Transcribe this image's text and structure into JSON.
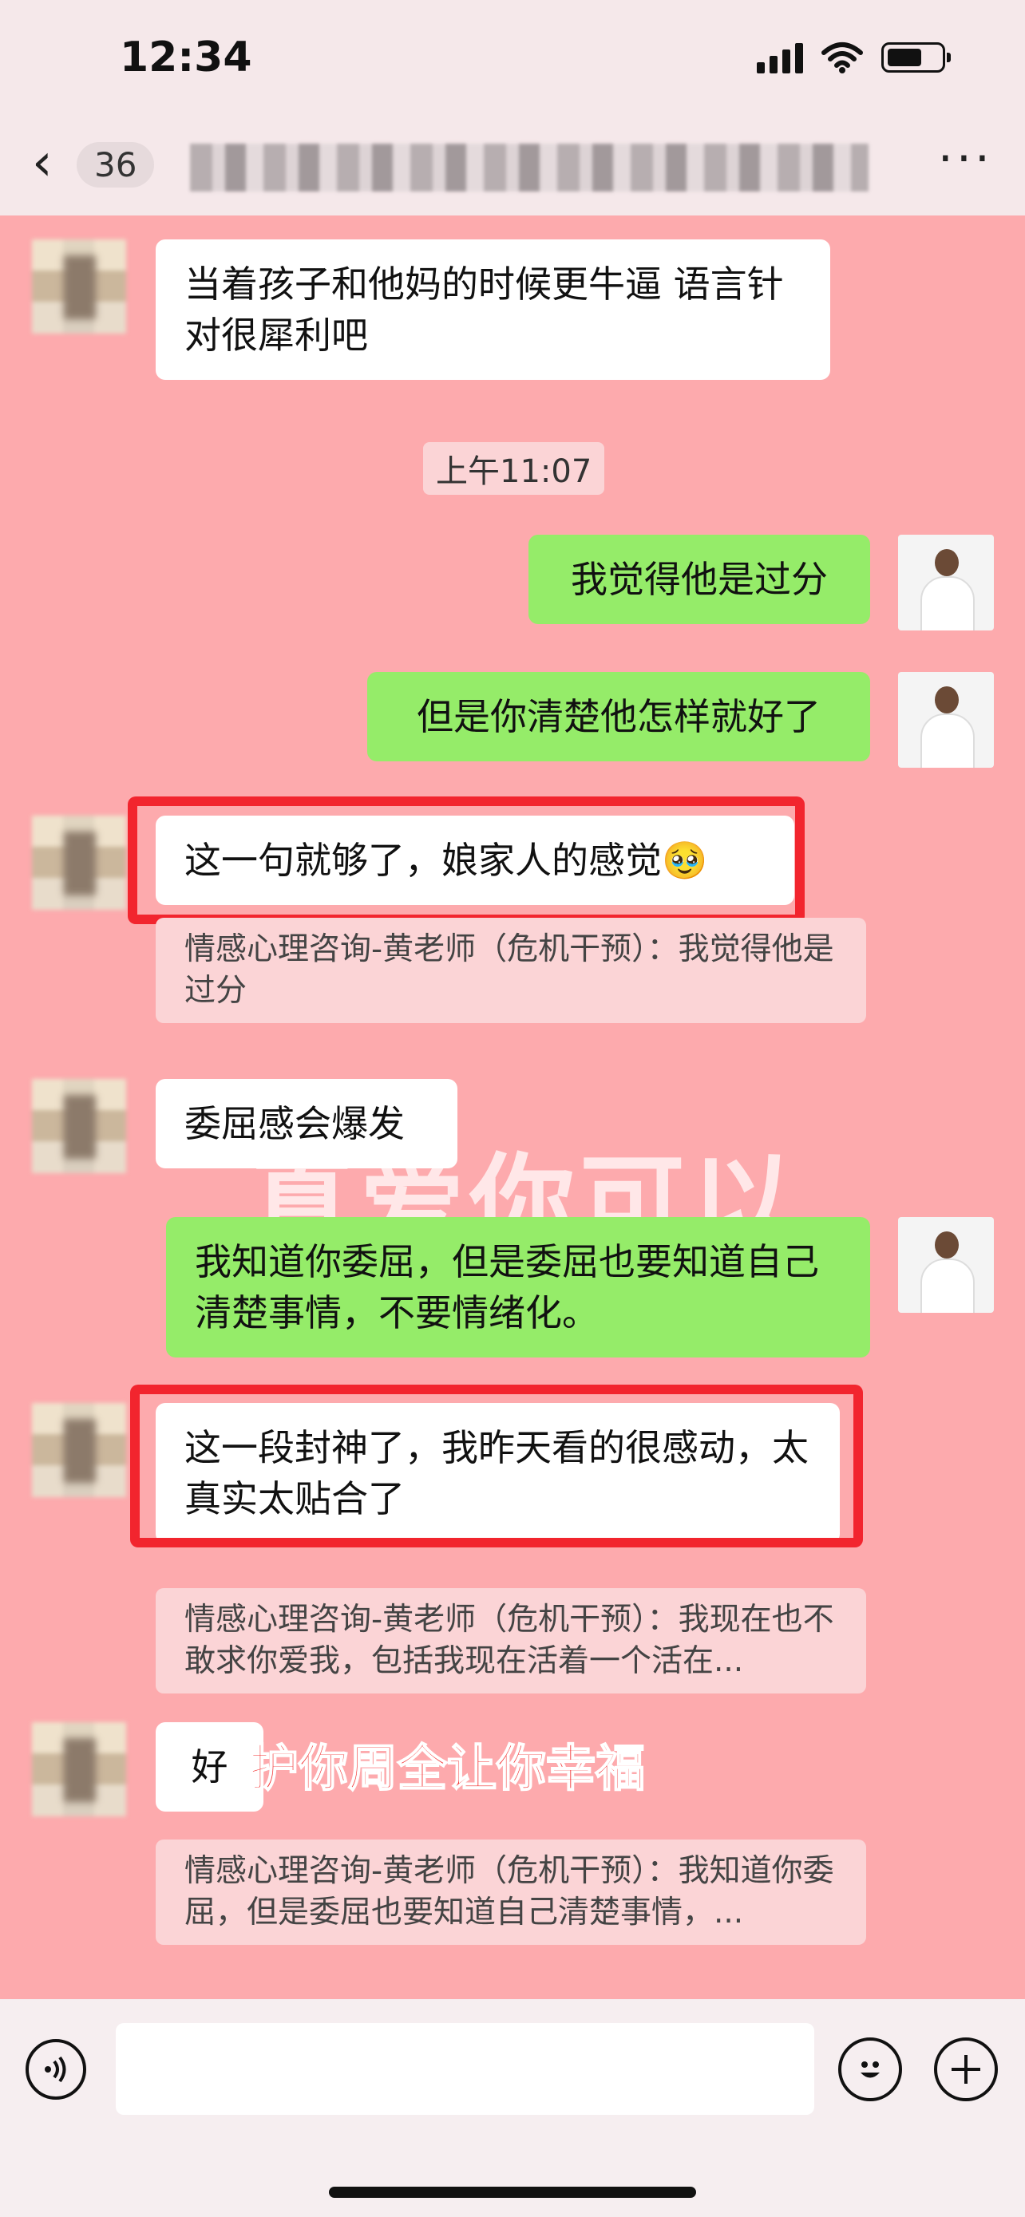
{
  "status": {
    "time": "12:34"
  },
  "nav": {
    "back_count": "36",
    "more_label": "···"
  },
  "timestamp": "上午11:07",
  "messages": [
    {
      "id": "m1",
      "side": "left",
      "text": "当着孩子和他妈的时候更牛逼 语言针对很犀利吧"
    },
    {
      "id": "m2",
      "side": "right",
      "text": "我觉得他是过分"
    },
    {
      "id": "m3",
      "side": "right",
      "text": "但是你清楚他怎样就好了"
    },
    {
      "id": "m4",
      "side": "left",
      "text": "这一句就够了，娘家人的感觉🥹",
      "highlighted": true,
      "quote": "情感心理咨询-黄老师（危机干预）：我觉得他是过分"
    },
    {
      "id": "m5",
      "side": "left",
      "text": "委屈感会爆发"
    },
    {
      "id": "m6",
      "side": "right",
      "text": "我知道你委屈，但是委屈也要知道自己清楚事情，不要情绪化。"
    },
    {
      "id": "m7",
      "side": "left",
      "text": "这一段封神了，我昨天看的很感动，太真实太贴合了",
      "highlighted": true,
      "quote": "情感心理咨询-黄老师（危机干预）：我现在也不敢求你爱我，包括我现在活着一个活在..."
    },
    {
      "id": "m8",
      "side": "left",
      "text": "好",
      "quote": "情感心理咨询-黄老师（危机干预）：我知道你委屈，但是委屈也要知道自己清楚事情，..."
    }
  ],
  "watermarks": {
    "big": "真爱你可以",
    "red": "护你周全让你幸福"
  },
  "colors": {
    "chat_bg": "#fdaaad",
    "right_bubble": "#95ec69",
    "highlight": "#f2252e"
  }
}
